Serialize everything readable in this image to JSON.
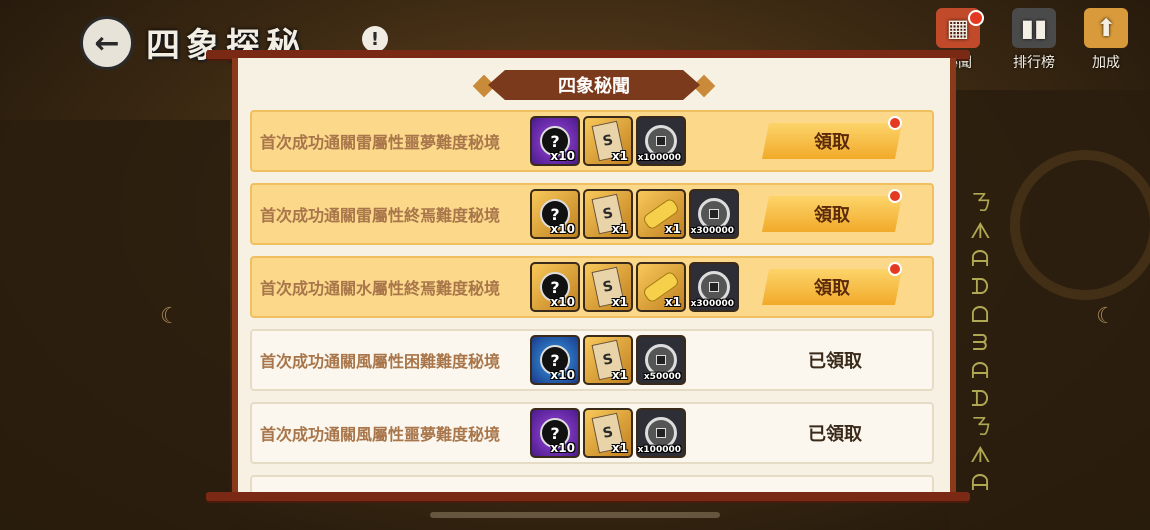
{
  "header": {
    "title": "四象探秘",
    "back_label": "←",
    "info_label": "!"
  },
  "top_icons": [
    {
      "name": "secret-icon",
      "label": "秘聞",
      "glyph": "▦",
      "color": "#c04a2a",
      "has_dot": true
    },
    {
      "name": "ranking-icon",
      "label": "排行榜",
      "glyph": "▮▮",
      "color": "#4a4a4a",
      "has_dot": false
    },
    {
      "name": "bonus-icon",
      "label": "加成",
      "glyph": "⬆",
      "color": "#d89a3a",
      "has_dot": false
    }
  ],
  "panel": {
    "title": "四象秘聞"
  },
  "rows": [
    {
      "text": "首次成功通關雷屬性噩夢難度秘境",
      "status": "claimable",
      "action": "領取",
      "rewards": [
        {
          "icon": "mystery-orb-icon",
          "bg": "purple",
          "kind": "orb",
          "count": "x10"
        },
        {
          "icon": "scroll-item-icon",
          "bg": "gold",
          "kind": "scroll",
          "count": "x1"
        },
        {
          "icon": "coin-icon",
          "bg": "dark",
          "kind": "coin",
          "count": "x100000"
        }
      ]
    },
    {
      "text": "首次成功通關雷屬性終焉難度秘境",
      "status": "claimable",
      "action": "領取",
      "rewards": [
        {
          "icon": "mystery-orb-icon",
          "bg": "gold",
          "kind": "orb",
          "count": "x10"
        },
        {
          "icon": "scroll-item-icon",
          "bg": "gold",
          "kind": "scroll",
          "count": "x1"
        },
        {
          "icon": "golden-scroll-icon",
          "bg": "gold",
          "kind": "goldscroll",
          "count": "x1"
        },
        {
          "icon": "coin-icon",
          "bg": "dark",
          "kind": "coin",
          "count": "x300000"
        }
      ]
    },
    {
      "text": "首次成功通關水屬性終焉難度秘境",
      "status": "claimable",
      "action": "領取",
      "rewards": [
        {
          "icon": "mystery-orb-icon",
          "bg": "gold",
          "kind": "orb",
          "count": "x10"
        },
        {
          "icon": "scroll-item-icon",
          "bg": "gold",
          "kind": "scroll",
          "count": "x1"
        },
        {
          "icon": "golden-scroll-icon",
          "bg": "gold",
          "kind": "goldscroll",
          "count": "x1"
        },
        {
          "icon": "coin-icon",
          "bg": "dark",
          "kind": "coin",
          "count": "x300000"
        }
      ]
    },
    {
      "text": "首次成功通關風屬性困難難度秘境",
      "status": "claimed",
      "action": "已領取",
      "rewards": [
        {
          "icon": "mystery-orb-icon",
          "bg": "blue",
          "kind": "orb",
          "count": "x10"
        },
        {
          "icon": "scroll-item-icon",
          "bg": "gold",
          "kind": "scroll",
          "count": "x1"
        },
        {
          "icon": "coin-icon",
          "bg": "dark",
          "kind": "coin",
          "count": "x50000"
        }
      ]
    },
    {
      "text": "首次成功通關風屬性噩夢難度秘境",
      "status": "claimed",
      "action": "已領取",
      "rewards": [
        {
          "icon": "mystery-orb-icon",
          "bg": "purple",
          "kind": "orb",
          "count": "x10"
        },
        {
          "icon": "scroll-item-icon",
          "bg": "gold",
          "kind": "scroll",
          "count": "x1"
        },
        {
          "icon": "coin-icon",
          "bg": "dark",
          "kind": "coin",
          "count": "x100000"
        }
      ]
    }
  ]
}
